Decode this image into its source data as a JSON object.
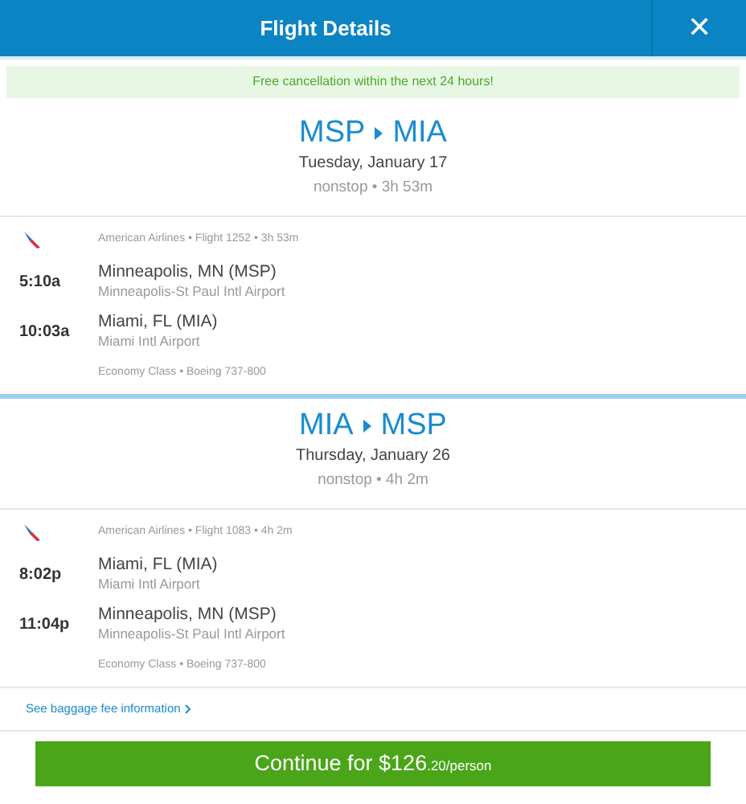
{
  "header": {
    "title": "Flight Details",
    "close": "✕"
  },
  "banner": "Free cancellation within the next 24 hours!",
  "trips": [
    {
      "from": "MSP",
      "to": "MIA",
      "date": "Tuesday, January 17",
      "summary": "nonstop • 3h 53m",
      "leg": {
        "airline": "American Airlines • Flight 1252 • 3h 53m",
        "stops": [
          {
            "time": "5:10a",
            "city": "Minneapolis, MN (MSP)",
            "airport": "Minneapolis-St Paul Intl Airport"
          },
          {
            "time": "10:03a",
            "city": "Miami, FL (MIA)",
            "airport": "Miami Intl Airport"
          }
        ],
        "details": "Economy Class • Boeing 737-800"
      }
    },
    {
      "from": "MIA",
      "to": "MSP",
      "date": "Thursday, January 26",
      "summary": "nonstop • 4h 2m",
      "leg": {
        "airline": "American Airlines • Flight 1083 • 4h 2m",
        "stops": [
          {
            "time": "8:02p",
            "city": "Miami, FL (MIA)",
            "airport": "Miami Intl Airport"
          },
          {
            "time": "11:04p",
            "city": "Minneapolis, MN (MSP)",
            "airport": "Minneapolis-St Paul Intl Airport"
          }
        ],
        "details": "Economy Class • Boeing 737-800"
      }
    }
  ],
  "baggage_link": "See baggage fee information",
  "continue_button": {
    "label": "Continue for $126",
    "suffix": ".20/person"
  }
}
